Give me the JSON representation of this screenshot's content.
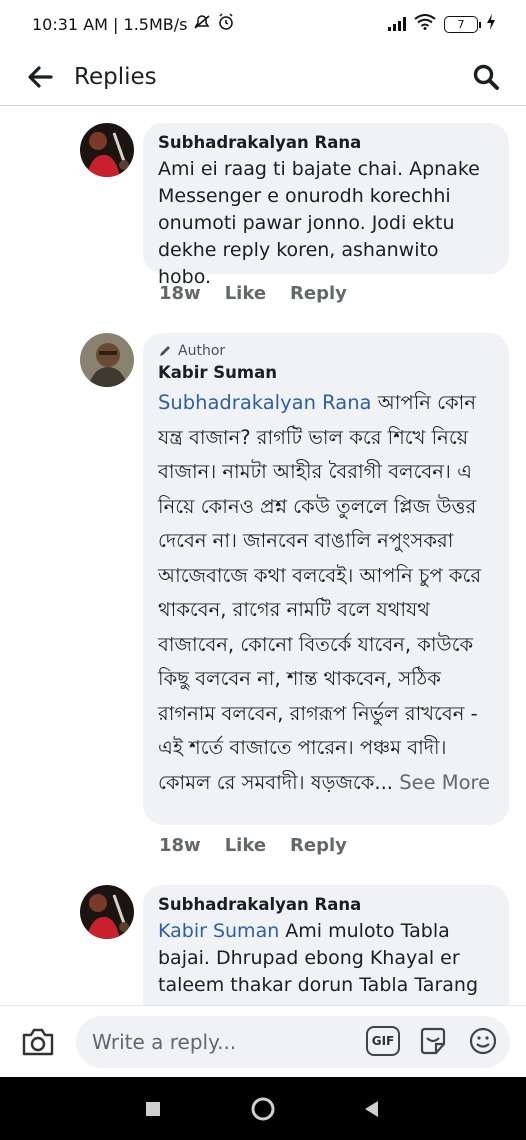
{
  "status_bar": {
    "time_text": "10:31 AM | 1.5MB/s",
    "battery": "7"
  },
  "header": {
    "title": "Replies"
  },
  "comments": [
    {
      "author": "Subhadrakalyan Rana",
      "text": "Ami ei raag ti bajate chai. Apnake Messenger e onurodh korechhi onumoti pawar jonno. Jodi ektu dekhe reply koren, ashanwito hobo.",
      "time": "18w",
      "like_label": "Like",
      "reply_label": "Reply"
    },
    {
      "author_tag": "Author",
      "author": "Kabir Suman",
      "mention": "Subhadrakalyan Rana",
      "text": " আপনি কোন যন্ত্র বাজান? রাগটি ভাল করে শিখে নিয়ে বাজান। নামটা আহীর বৈরাগী বলবেন। এ নিয়ে কোনও প্রশ্ন কেউ তুললে প্লিজ উত্তর দেবেন না। জানবেন বাঙালি নপুংসকরা আজেবাজে কথা বলবেই। আপনি চুপ করে থাকবেন, রাগের নামটি বলে যথাযথ বাজাবেন, কোনো বিতর্কে যাবেন, কাউকে কিছু বলবেন না, শান্ত থাকবেন, সঠিক রাগনাম বলবেন,  রাগরূপ নির্ভুল রাখবেন - এই শর্তে বাজাতে পারেন। পঞ্চম বাদী। কোমল রে সমবাদী। ষড়জকে...",
      "see_more": " See More",
      "time": "18w",
      "like_label": "Like",
      "reply_label": "Reply"
    },
    {
      "author": "Subhadrakalyan Rana",
      "mention": "Kabir Suman",
      "text": " Ami muloto Tabla bajai. Dhrupad ebong Khayal er taleem thakar dorun Tabla Tarang"
    }
  ],
  "composer": {
    "placeholder": "Write a reply...",
    "gif_label": "GIF"
  },
  "icons": {
    "back": "arrow-left",
    "search": "magnifier",
    "camera": "camera",
    "sticker": "sticker",
    "emoji": "smiley",
    "nav_recents": "square",
    "nav_home": "circle",
    "nav_back": "triangle"
  }
}
